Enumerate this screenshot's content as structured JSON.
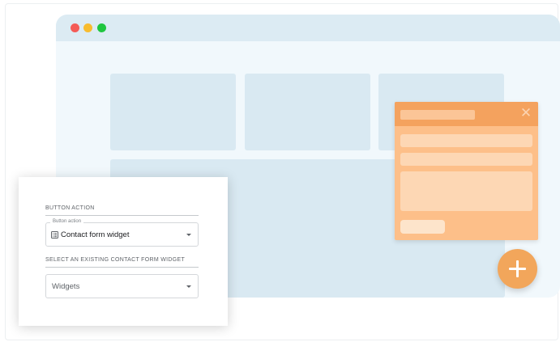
{
  "illustration": {
    "window_dots": [
      "#f45b56",
      "#f8bc2e",
      "#1fc63f"
    ],
    "widget": {
      "close_icon": "close-icon",
      "accent": "#f4a25e"
    },
    "fab": {
      "icon": "plus-icon",
      "color": "#f2a65b"
    }
  },
  "settings_panel": {
    "button_action_section": "BUTTON ACTION",
    "button_action_field": {
      "legend": "Button action",
      "value": "Contact form widget",
      "icon": "form-list-icon"
    },
    "contact_widget_section": "SELECT AN EXISTING CONTACT FORM WIDGET",
    "widgets_field": {
      "placeholder": "Widgets"
    }
  }
}
